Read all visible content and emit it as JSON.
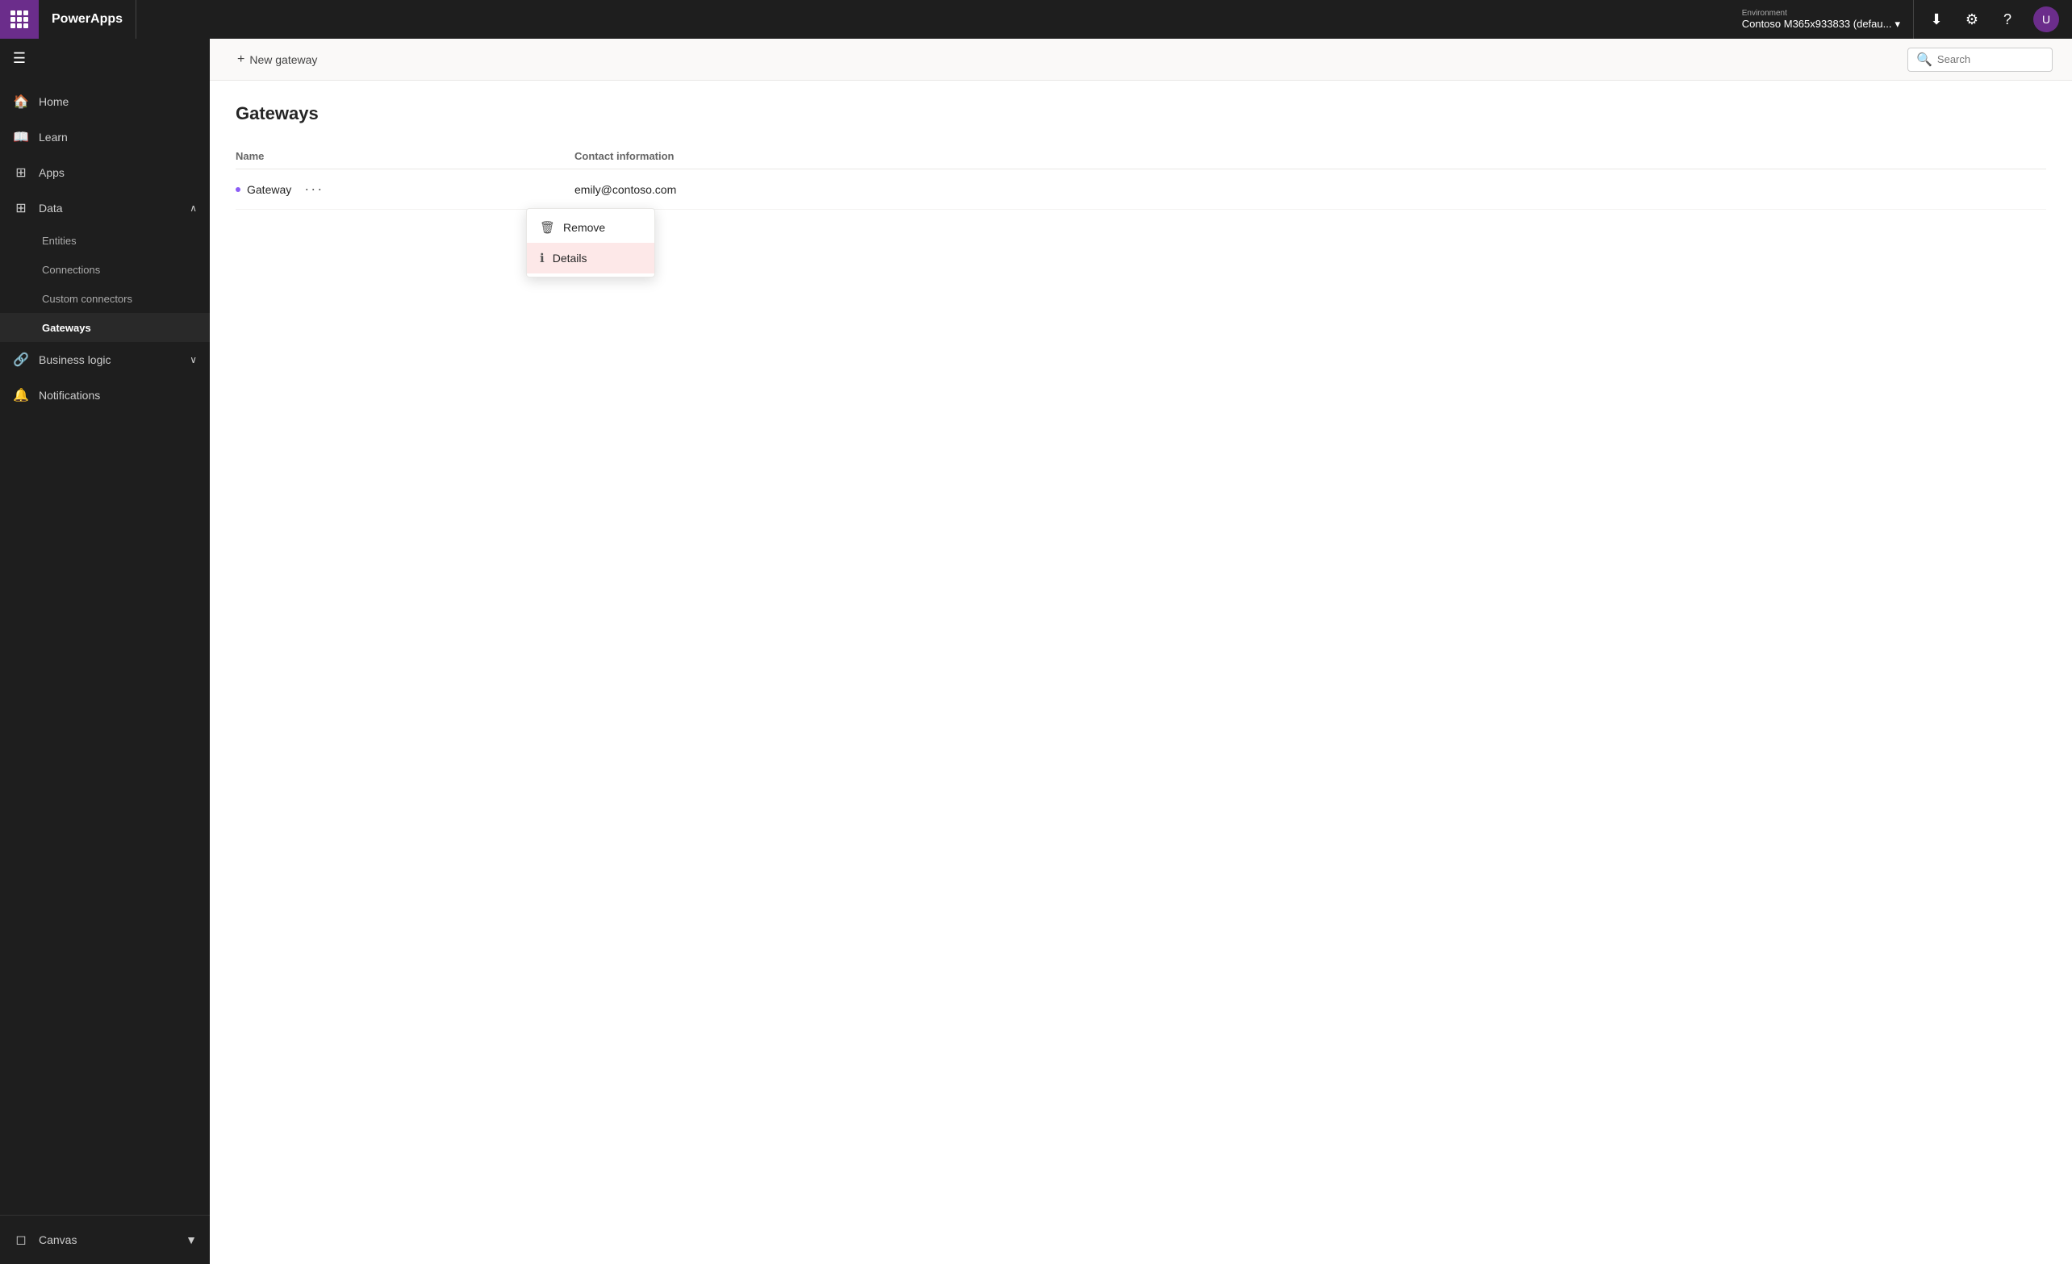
{
  "app": {
    "title": "PowerApps"
  },
  "topbar": {
    "brand": "PowerApps",
    "env_label": "Environment",
    "env_value": "Contoso M365x933833 (defau...",
    "download_icon": "⬇",
    "settings_icon": "⚙",
    "help_icon": "?",
    "avatar_letter": "U"
  },
  "sidebar": {
    "toggle_icon": "☰",
    "items": [
      {
        "id": "home",
        "label": "Home",
        "icon": "🏠"
      },
      {
        "id": "learn",
        "label": "Learn",
        "icon": "📖"
      },
      {
        "id": "apps",
        "label": "Apps",
        "icon": "📱"
      },
      {
        "id": "data",
        "label": "Data",
        "icon": "⊞",
        "expanded": true
      },
      {
        "id": "business-logic",
        "label": "Business logic",
        "icon": "🔗",
        "expanded": false
      },
      {
        "id": "notifications",
        "label": "Notifications",
        "icon": "🔔"
      }
    ],
    "data_sub_items": [
      {
        "id": "entities",
        "label": "Entities"
      },
      {
        "id": "connections",
        "label": "Connections"
      },
      {
        "id": "custom-connectors",
        "label": "Custom connectors"
      },
      {
        "id": "gateways",
        "label": "Gateways",
        "active": true
      }
    ],
    "bottom": {
      "label": "Canvas",
      "arrow": "▼"
    }
  },
  "action_bar": {
    "new_gateway_label": "New gateway",
    "search_placeholder": "Search"
  },
  "page": {
    "title": "Gateways",
    "table": {
      "col_name": "Name",
      "col_contact": "Contact information",
      "rows": [
        {
          "name": "Gateway",
          "contact": "emily@contoso.com"
        }
      ]
    },
    "dropdown": {
      "items": [
        {
          "id": "remove",
          "label": "Remove",
          "icon": "🗑"
        },
        {
          "id": "details",
          "label": "Details",
          "icon": "ℹ",
          "hovered": true
        }
      ]
    }
  }
}
